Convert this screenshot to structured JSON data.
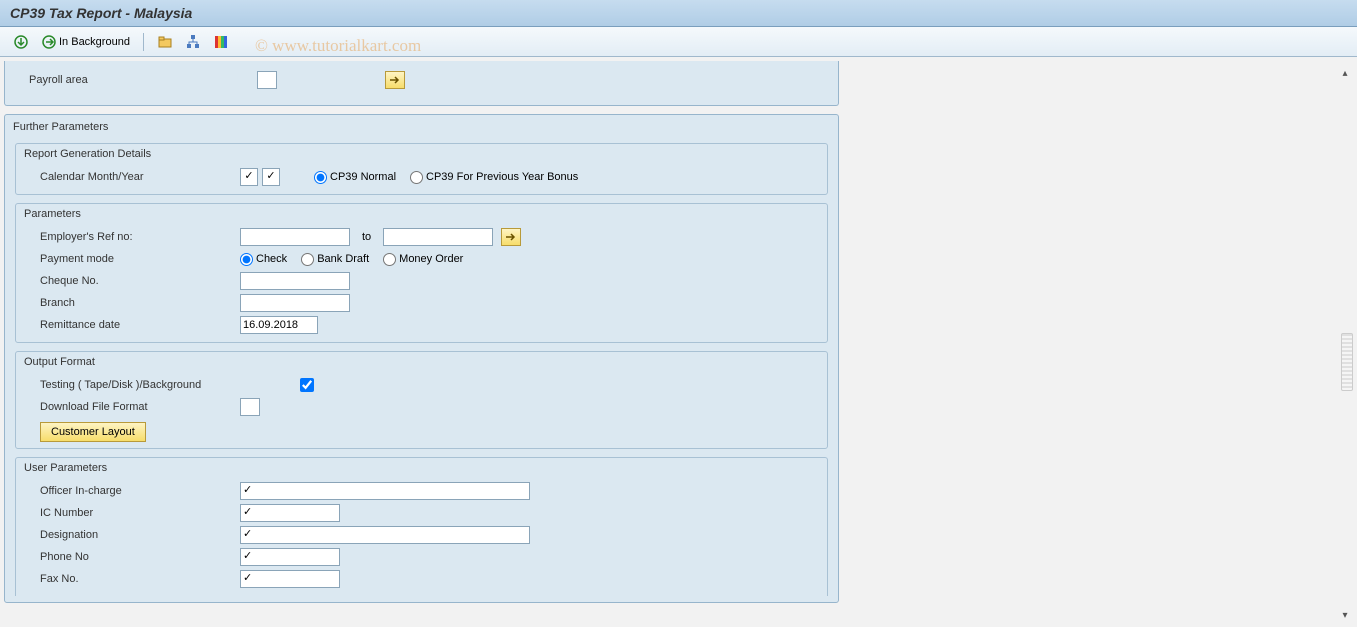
{
  "title": "CP39 Tax Report - Malaysia",
  "toolbar": {
    "in_background": "In Background"
  },
  "watermark": "© www.tutorialkart.com",
  "top": {
    "payroll_area": "Payroll area"
  },
  "further_parameters": "Further Parameters",
  "report_gen": {
    "title": "Report Generation Details",
    "calendar": "Calendar Month/Year",
    "cp39_normal": "CP39 Normal",
    "cp39_prev": "CP39 For Previous Year Bonus"
  },
  "params": {
    "title": "Parameters",
    "emp_ref": "Employer's Ref no:",
    "to": "to",
    "pay_mode": "Payment mode",
    "check": "Check",
    "bank_draft": "Bank Draft",
    "money_order": "Money Order",
    "cheque": "Cheque No.",
    "branch": "Branch",
    "remit": "Remittance date",
    "remit_val": "16.09.2018"
  },
  "output": {
    "title": "Output Format",
    "testing": "Testing ( Tape/Disk )/Background",
    "download": "Download File Format",
    "customer_layout": "Customer Layout"
  },
  "user": {
    "title": "User Parameters",
    "officer": "Officer In-charge",
    "ic": "IC Number",
    "designation": "Designation",
    "phone": "Phone No",
    "fax": "Fax No."
  }
}
